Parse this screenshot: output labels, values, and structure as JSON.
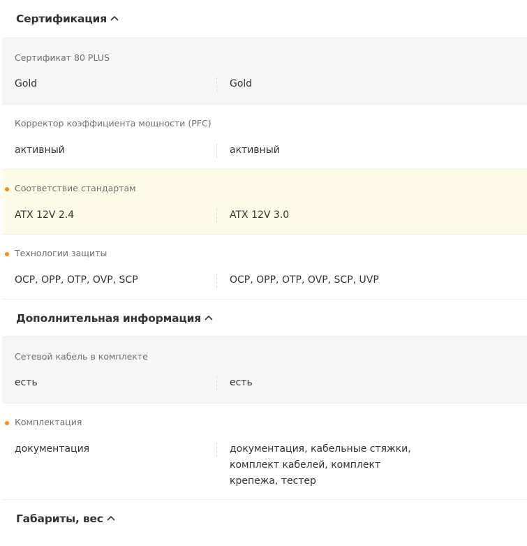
{
  "sections": [
    {
      "title": "Сертификация",
      "rows": [
        {
          "label": "Сертификат 80 PLUS",
          "values": [
            "Gold",
            "Gold"
          ],
          "diff": false
        },
        {
          "label": "Корректор коэффициента мощности (PFC)",
          "values": [
            "активный",
            "активный"
          ],
          "diff": false
        },
        {
          "label": "Соответствие стандартам",
          "values": [
            "ATX 12V 2.4",
            "ATX 12V 3.0"
          ],
          "diff": true
        },
        {
          "label": "Технологии защиты",
          "values": [
            "OCP, OPP, OTP, OVP, SCP",
            "OCP, OPP, OTP, OVP, SCP, UVP"
          ],
          "diff": true
        }
      ]
    },
    {
      "title": "Дополнительная информация",
      "rows": [
        {
          "label": "Сетевой кабель в комплекте",
          "values": [
            "есть",
            "есть"
          ],
          "diff": false
        },
        {
          "label": "Комплектация",
          "values": [
            "документация",
            "документация, кабельные стяжки, комплект кабелей, комплект крепежа, тестер"
          ],
          "diff": true
        }
      ]
    },
    {
      "title": "Габариты, вес",
      "rows": []
    }
  ],
  "colors": {
    "diff_dot": "#ff8c00",
    "highlight_row": "#fefce9",
    "gray_row": "#f6f6f6"
  }
}
